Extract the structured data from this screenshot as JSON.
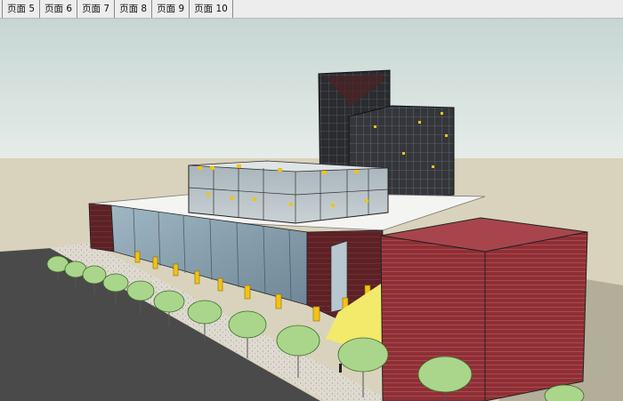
{
  "tabs": [
    {
      "label": "页面 5"
    },
    {
      "label": "页面 6"
    },
    {
      "label": "页面 7"
    },
    {
      "label": "页面 8"
    },
    {
      "label": "页面 9"
    },
    {
      "label": "页面 10"
    }
  ],
  "viewport": {
    "colors": {
      "sky_top": "#c6d6d2",
      "sky_bottom": "#e6ecea",
      "ground": "#d9d3bd",
      "road": "#4a4a4a",
      "sidewalk": "#dedad0",
      "brick": "#8e2f36",
      "brick_dark": "#5e1f24",
      "glass": "#8ea6b4",
      "tower": "#2a2a2c",
      "column": "#f2c313",
      "plaza": "#f3e96a",
      "tree": "#a9d68a"
    }
  }
}
